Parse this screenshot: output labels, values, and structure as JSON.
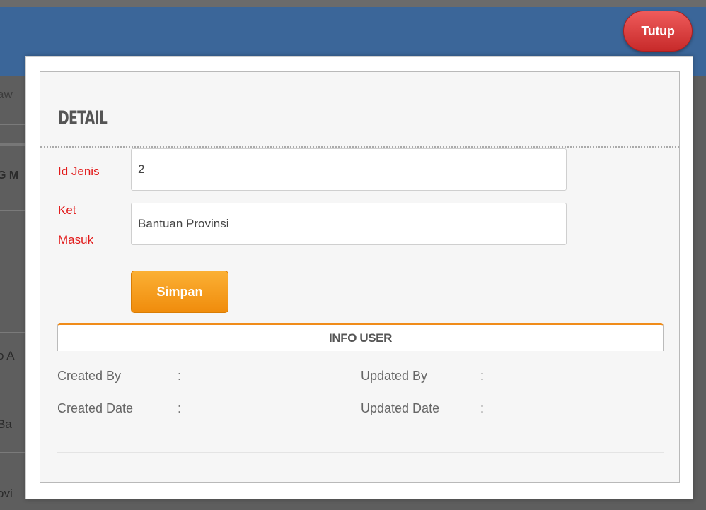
{
  "background": {
    "fragments": [
      "aw",
      "G M",
      "o A",
      "Ba",
      "ovi"
    ]
  },
  "close_button": {
    "label": "Tutup"
  },
  "detail": {
    "title": "DETAIL",
    "fields": {
      "id_jenis": {
        "label": "Id Jenis",
        "value": "2"
      },
      "ket_masuk": {
        "label_line1": "Ket",
        "label_line2": "Masuk",
        "value": "Bantuan Provinsi"
      }
    },
    "save_label": "Simpan"
  },
  "info_user": {
    "title": "INFO USER",
    "created_by": {
      "label": "Created By",
      "sep": ":"
    },
    "created_date": {
      "label": "Created Date",
      "sep": ":"
    },
    "updated_by": {
      "label": "Updated By",
      "sep": ":"
    },
    "updated_date": {
      "label": "Updated Date",
      "sep": ":"
    }
  },
  "colors": {
    "topbar": "#3b6699",
    "close_button": "#d63838",
    "save_button": "#f39a1a",
    "label_required": "#e21a1a",
    "info_accent": "#f08c1a"
  }
}
